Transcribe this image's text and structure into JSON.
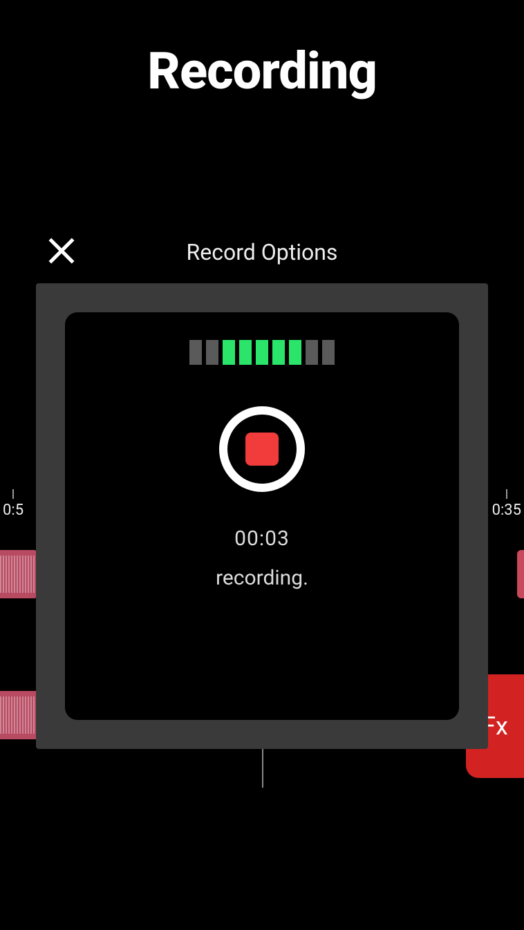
{
  "page": {
    "title": "Recording"
  },
  "modal": {
    "title": "Record Options",
    "elapsed": "00:03",
    "status": "recording.",
    "level_segments": [
      {
        "on": false
      },
      {
        "on": false
      },
      {
        "on": true
      },
      {
        "on": true
      },
      {
        "on": true
      },
      {
        "on": true
      },
      {
        "on": true
      },
      {
        "on": false
      },
      {
        "on": false
      }
    ]
  },
  "timeline": {
    "tick_left": "0:5",
    "tick_right": "0:35"
  },
  "fx": {
    "label": "Fx"
  }
}
